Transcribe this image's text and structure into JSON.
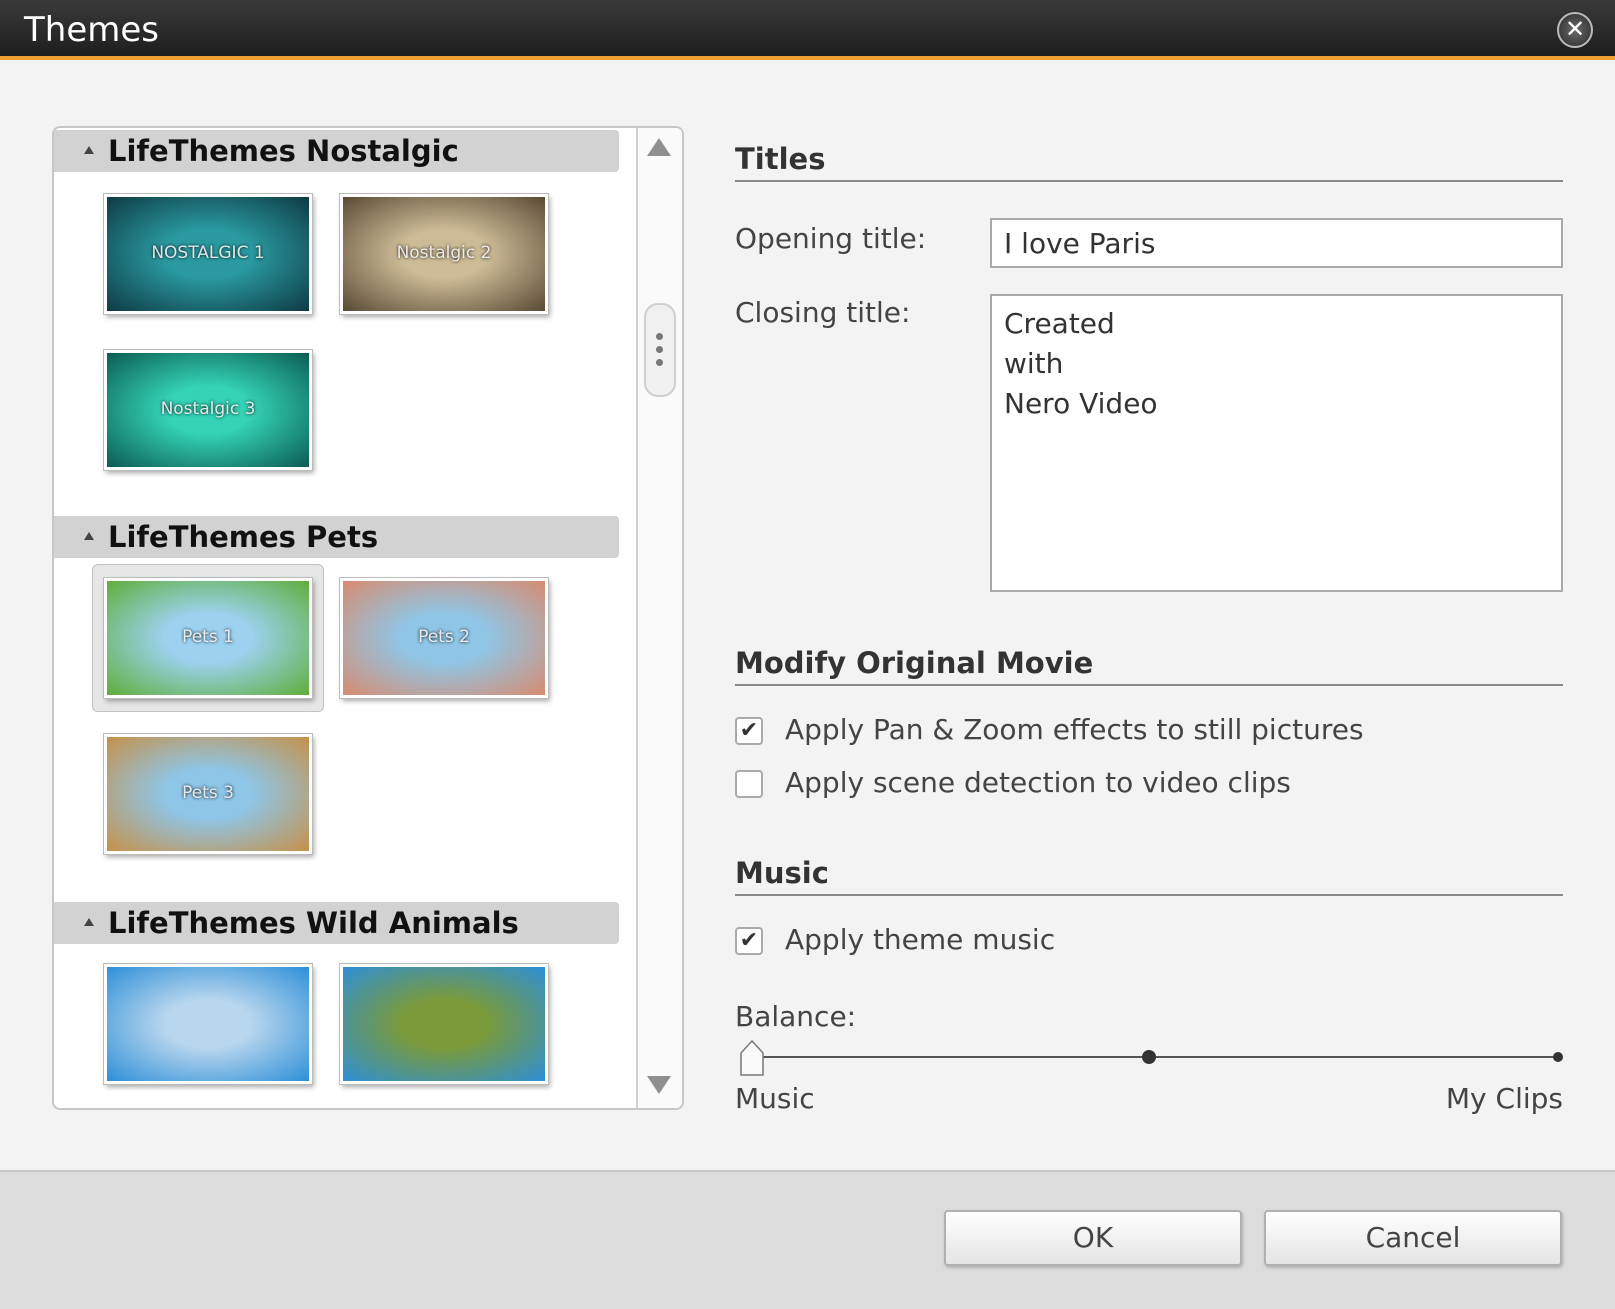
{
  "window": {
    "title": "Themes"
  },
  "theme_groups": [
    {
      "name": "LifeThemes Nostalgic",
      "themes": [
        {
          "label": "NOSTALGIC 1",
          "colors": [
            "#2a9aa0",
            "#0e3a44"
          ]
        },
        {
          "label": "Nostalgic 2",
          "colors": [
            "#cdbb97",
            "#5a4a34"
          ]
        },
        {
          "label": "Nostalgic 3",
          "colors": [
            "#34d2b6",
            "#0b5c52"
          ]
        }
      ]
    },
    {
      "name": "LifeThemes Pets",
      "themes": [
        {
          "label": "Pets 1",
          "colors": [
            "#9cd2f0",
            "#5fae3a"
          ]
        },
        {
          "label": "Pets 2",
          "colors": [
            "#8fc6e6",
            "#d88b70"
          ]
        },
        {
          "label": "Pets 3",
          "colors": [
            "#8ec6e8",
            "#c69048"
          ]
        }
      ]
    },
    {
      "name": "LifeThemes Wild Animals",
      "themes": [
        {
          "label": "",
          "colors": [
            "#b8d6ee",
            "#2d8fd8"
          ]
        },
        {
          "label": "",
          "colors": [
            "#7a9a3a",
            "#2d8fd8"
          ]
        }
      ]
    }
  ],
  "titles": {
    "heading": "Titles",
    "opening_label": "Opening title:",
    "opening_value": "I love Paris",
    "closing_label": "Closing title:",
    "closing_lines": [
      "Created",
      "with",
      "Nero Video"
    ]
  },
  "modify": {
    "heading": "Modify Original Movie",
    "pan_zoom_label": "Apply Pan & Zoom effects to still pictures",
    "pan_zoom_checked": true,
    "scene_detect_label": "Apply scene detection to video clips",
    "scene_detect_checked": false
  },
  "music": {
    "heading": "Music",
    "theme_music_label": "Apply theme music",
    "theme_music_checked": true,
    "balance_label": "Balance:",
    "left_label": "Music",
    "right_label": "My Clips",
    "balance_value": 0
  },
  "buttons": {
    "ok": "OK",
    "cancel": "Cancel"
  },
  "colors": {
    "accent": "#f0a030",
    "titlebar": "#2a2a2a"
  }
}
